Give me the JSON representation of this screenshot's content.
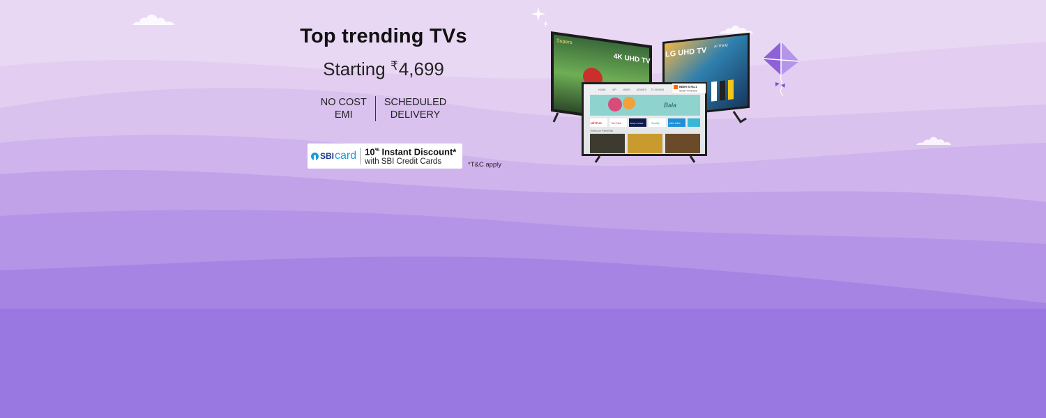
{
  "banner": {
    "headline": "Top trending TVs",
    "price_prefix": "Starting",
    "currency_symbol": "₹",
    "price": "4,699",
    "features": [
      {
        "line1": "NO COST",
        "line2": "EMI"
      },
      {
        "line1": "SCHEDULED",
        "line2": "DELIVERY"
      }
    ],
    "bank_offer": {
      "logo_text": "SBI",
      "logo_card": "card",
      "discount_value": "10",
      "discount_unit": "%",
      "discount_text": "Instant Discount*",
      "subtitle": "with SBI Credit Cards"
    },
    "terms": "*T&C apply",
    "products": {
      "tv_left_label": "4K UHD TV",
      "tv_left_brand": "Supero",
      "tv_right_label": "LG UHD TV",
      "tv_right_badge": "AI ThinQ",
      "tv_center_badge_line1": "INDIA'S No.1",
      "tv_center_badge_line2": "Smart TV Brand",
      "tv_center_nav": [
        "HOME",
        "VIP",
        "NEWS",
        "MOVIES",
        "TV SHOWS"
      ],
      "tv_center_apps": [
        "NETFLIX",
        "YouTube",
        "Disney+ hotstar",
        "Spotify",
        "prime video"
      ],
      "tv_center_row_label": "Trends on PatchWall",
      "tv_center_feature_title": "Bala"
    },
    "colors": {
      "bg_top": "#e8d6f3",
      "bg_bottom": "#9a78e2",
      "sbi_blue": "#1b9bd8",
      "kite": "#8e62d6"
    }
  }
}
